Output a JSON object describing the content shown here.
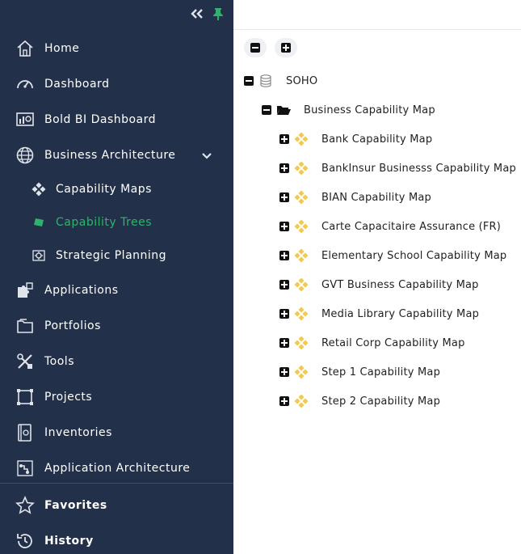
{
  "sidebar": {
    "items": [
      {
        "label": "Home",
        "icon": "home-icon"
      },
      {
        "label": "Dashboard",
        "icon": "gauge-icon"
      },
      {
        "label": "Bold BI Dashboard",
        "icon": "bi-dashboard-icon"
      },
      {
        "label": "Business Architecture",
        "icon": "globe-icon"
      },
      {
        "label": "Capability Maps",
        "icon": "capability-maps-icon"
      },
      {
        "label": "Capability Trees",
        "icon": "capability-trees-icon"
      },
      {
        "label": "Strategic Planning",
        "icon": "strategic-planning-icon"
      },
      {
        "label": "Applications",
        "icon": "puzzle-icon"
      },
      {
        "label": "Portfolios",
        "icon": "folder-icon"
      },
      {
        "label": "Tools",
        "icon": "tools-icon"
      },
      {
        "label": "Projects",
        "icon": "projects-icon"
      },
      {
        "label": "Inventories",
        "icon": "inventory-icon"
      },
      {
        "label": "Application Architecture",
        "icon": "app-architecture-icon"
      },
      {
        "label": "Favorites",
        "icon": "star-icon"
      },
      {
        "label": "History",
        "icon": "history-icon"
      }
    ]
  },
  "tree": {
    "root": {
      "label": "SOHO"
    },
    "group": {
      "label": "Business Capability Map"
    },
    "children": [
      {
        "label": "Bank Capability Map"
      },
      {
        "label": "BankInsur Businesss Capability Map"
      },
      {
        "label": "BIAN Capability Map"
      },
      {
        "label": "Carte Capacitaire Assurance (FR)"
      },
      {
        "label": "Elementary School Capability Map"
      },
      {
        "label": "GVT Business Capability Map"
      },
      {
        "label": "Media Library Capability Map"
      },
      {
        "label": "Retail Corp Capability Map"
      },
      {
        "label": "Step 1 Capability Map"
      },
      {
        "label": "Step 2 Capability Map"
      }
    ]
  },
  "colors": {
    "sidebar_bg": "#23304a",
    "active": "#2fb36c",
    "map_icon": "#f2c94c"
  }
}
